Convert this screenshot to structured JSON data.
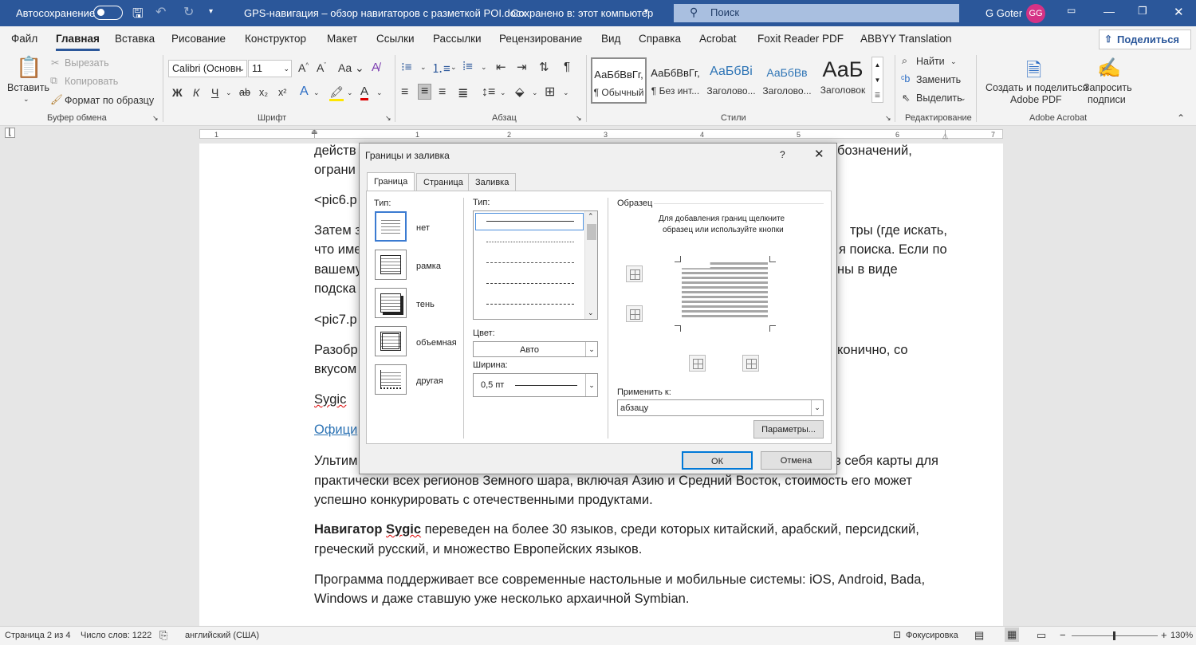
{
  "titlebar": {
    "autosave": "Автосохранение",
    "filename": "GPS-навигация – обзор навигаторов с разметкой POI.docx",
    "save_status": "Сохранено в: этот компьютер",
    "search": "Поиск",
    "user": "G Goter",
    "initials": "GG"
  },
  "menu": {
    "tabs": [
      "Файл",
      "Главная",
      "Вставка",
      "Рисование",
      "Конструктор",
      "Макет",
      "Ссылки",
      "Рассылки",
      "Рецензирование",
      "Вид",
      "Справка",
      "Acrobat",
      "Foxit Reader PDF",
      "ABBYY Translation"
    ],
    "share": "Поделиться"
  },
  "ribbon": {
    "clipboard": {
      "paste": "Вставить",
      "cut": "Вырезать",
      "copy": "Копировать",
      "format_painter": "Формат по образцу",
      "group": "Буфер обмена"
    },
    "font": {
      "name": "Calibri (Основн",
      "size": "11",
      "bold": "Ж",
      "italic": "К",
      "underline": "Ч",
      "group": "Шрифт"
    },
    "paragraph": {
      "group": "Абзац"
    },
    "styles": {
      "items": [
        {
          "preview": "АаБбВвГг,",
          "label": "¶ Обычный"
        },
        {
          "preview": "АаБбВвГг,",
          "label": "¶ Без инт..."
        },
        {
          "preview": "АаБбВі",
          "label": "Заголово..."
        },
        {
          "preview": "АаБбВв",
          "label": "Заголово..."
        },
        {
          "preview": "АаБ",
          "label": "Заголовок"
        }
      ],
      "group": "Стили"
    },
    "editing": {
      "find": "Найти",
      "replace": "Заменить",
      "select": "Выделить",
      "group": "Редактирование"
    },
    "acrobat": {
      "create": "Создать и поделиться",
      "create2": "Adobe PDF",
      "request": "Запросить",
      "request2": "подписи",
      "group": "Adobe Acrobat"
    }
  },
  "ruler": {
    "ticks": [
      "1",
      "1",
      "2",
      "3",
      "4",
      "5",
      "6",
      "7"
    ]
  },
  "document": {
    "l1a": "действ",
    "l1b": "бозначений,",
    "l2": "ограни",
    "l3": "<pic6.p",
    "l4a": "Затем з",
    "l4b": "тры (где искать,",
    "l5a": "что име",
    "l5b": "я поиска. Если по",
    "l6a": "вашему",
    "l6b": "ны в виде",
    "l7": "подска",
    "l8": "<pic7.p",
    "l9a": "Разобр",
    "l9b": "конично, со",
    "l10": "вкусом",
    "l11": "Sygic",
    "l12": "Офици",
    "l13a": "Ультим",
    "l13b": "в себя карты для",
    "p2": "практически всех регионов Земного шара, включая Азию и Средний Восток, стоимость его может",
    "p3": "успешно конкурировать с отечественными продуктами.",
    "p4_bold": "Навигатор",
    "p4_sygic": "Sygic",
    "p4_rest": " переведен на более 30 языков, среди которых китайский, арабский, персидский,",
    "p5": "греческий русский, и множество Европейских языков.",
    "p6": "Программа поддерживает все современные настольные и мобильные системы: iOS, Android, Bada,",
    "p7": "Windows и даже ставшую уже несколько архаичной Symbian."
  },
  "dialog": {
    "title": "Границы и заливка",
    "help": "?",
    "tabs": [
      "Граница",
      "Страница",
      "Заливка"
    ],
    "type_label": "Тип:",
    "settings": [
      "нет",
      "рамка",
      "тень",
      "объемная",
      "другая"
    ],
    "style_label": "Тип:",
    "color_label": "Цвет:",
    "color_value": "Авто",
    "width_label": "Ширина:",
    "width_value": "0,5 пт",
    "preview_label": "Образец",
    "preview_hint1": "Для добавления границ щелкните",
    "preview_hint2": "образец или используйте кнопки",
    "apply_label": "Применить к:",
    "apply_value": "абзацу",
    "options": "Параметры...",
    "ok": "ОК",
    "cancel": "Отмена"
  },
  "status": {
    "page": "Страница 2 из 4",
    "words": "Число слов: 1222",
    "lang": "английский (США)",
    "focus": "Фокусировка",
    "zoom": "130%"
  }
}
